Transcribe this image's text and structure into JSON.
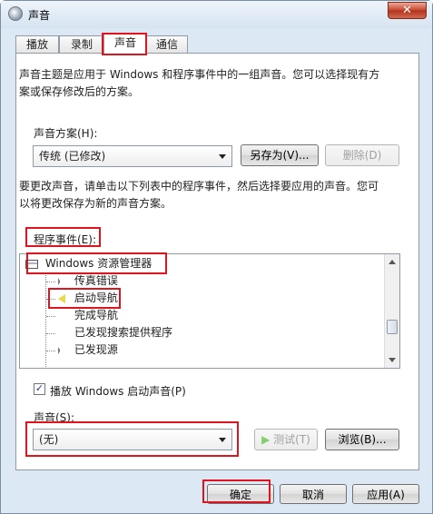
{
  "window": {
    "title": "声音",
    "close_glyph": "✕"
  },
  "tabs": [
    {
      "label": "播放"
    },
    {
      "label": "录制"
    },
    {
      "label": "声音"
    },
    {
      "label": "通信"
    }
  ],
  "intro_text": [
    "声音主题是应用于 Windows 和程序事件中的一组声音。您可以选择现有方",
    "案或保存修改后的方案。"
  ],
  "scheme": {
    "label": "声音方案(H):",
    "value": "传统 (已修改)",
    "save_as_label": "另存为(V)...",
    "delete_label": "删除(D)"
  },
  "instructions_text": [
    "要更改声音，请单击以下列表中的程序事件，然后选择要应用的声音。您可",
    "以将更改保存为新的声音方案。"
  ],
  "events": {
    "label": "程序事件(E):",
    "group": "Windows 资源管理器",
    "items": [
      {
        "label": "传真错误",
        "has_sound": true
      },
      {
        "label": "启动导航",
        "has_sound": true
      },
      {
        "label": "完成导航",
        "has_sound": false
      },
      {
        "label": "已发现搜索提供程序",
        "has_sound": false
      },
      {
        "label": "已发现源",
        "has_sound": true
      }
    ]
  },
  "startup_sound": {
    "label": "播放 Windows 启动声音(P)",
    "checked": true
  },
  "sound": {
    "label": "声音(S):",
    "value": "(无)",
    "test_label": "测试(T)",
    "browse_label": "浏览(B)..."
  },
  "footer": {
    "ok_label": "确定",
    "cancel_label": "取消",
    "apply_label": "应用(A)"
  },
  "colors": {
    "highlight": "#e0141e",
    "speaker": "#e8d84a"
  }
}
